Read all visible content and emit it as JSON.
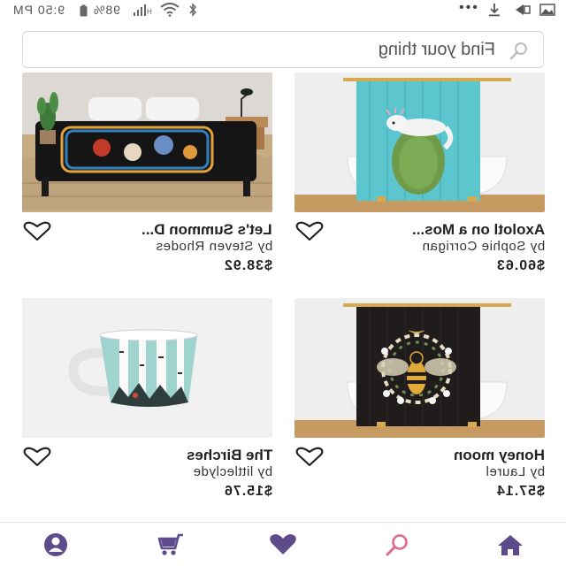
{
  "status_bar": {
    "time": "9:50 PM",
    "battery": "98%",
    "menu_dots": "•••"
  },
  "search": {
    "placeholder": "Find your thing"
  },
  "products": [
    {
      "title": "Let's Summon D...",
      "artist": "by Steven Rhodes",
      "price": "$38.92",
      "image_icon": "duvet-cover-image"
    },
    {
      "title": "Axolotl on a Mos...",
      "artist": "by Sophie Corrigan",
      "price": "$60.63",
      "image_icon": "shower-curtain-image"
    },
    {
      "title": "The Birches",
      "artist": "by littleclyde",
      "price": "$15.76",
      "image_icon": "mug-image"
    },
    {
      "title": "Honey moon",
      "artist": "by Laurel",
      "price": "$57.14",
      "image_icon": "shower-curtain-image"
    }
  ],
  "bottom_nav": {
    "items": [
      "account-icon",
      "cart-icon",
      "heart-icon",
      "search-icon",
      "home-icon"
    ]
  },
  "colors": {
    "nav_accent": "#5e4b8b",
    "search_accent": "#e06a8c",
    "text": "#222222"
  }
}
